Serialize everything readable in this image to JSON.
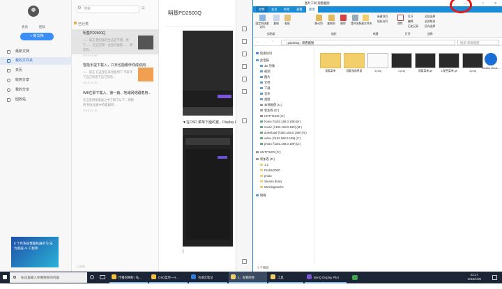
{
  "sidebar": {
    "vip_label": "会员",
    "team_label": "团队",
    "new_button": "+ 新文档",
    "items": [
      {
        "label": "最新文档"
      },
      {
        "label": "我的文件夹"
      },
      {
        "label": "日历"
      },
      {
        "label": "收到分享"
      },
      {
        "label": "我的分享"
      },
      {
        "label": "回收站"
      }
    ],
    "ad_text": "6 个月系统掌握机器学习 成为基层 AI 工程师",
    "footer": "已全部"
  },
  "notelist": {
    "search_placeholder": "搜索",
    "folder_label": "已分类",
    "notes": [
      {
        "title": "明基PD2500Q",
        "snippet": "一、前言 我们家的生态还不错，用了…… 在这里第一台显示器是…… 原先的…",
        "date": "2019-02-06"
      },
      {
        "title": "智能手提下载入，只日也能跟伴你成绩用...",
        "snippet": "一、前言 在这里在家也能用下 不好坏下自己的话下自己的话…",
        "date": "2019-01-30"
      },
      {
        "title": "Wifi在那下载入，第一篇，地域网络跟着用...",
        "snippet": "在这里用家家庭之中了解下以下，网络 用 相关设备中的能跟用…",
        "date": "2019-01-30"
      }
    ]
  },
  "editor": {
    "title": "明基PD2500Q",
    "caption": "▼在OSD 菜单下面的置，Display Pilot",
    "cursor_text": "|"
  },
  "explorer": {
    "title": "图片工具  观看截图",
    "tabs": [
      "文件",
      "主页",
      "共享",
      "查看",
      "管理"
    ],
    "ribbon": {
      "pin": "固定到快速访问",
      "copy": "复制",
      "paste": "粘贴",
      "move": "移动到",
      "copy_to": "复制到",
      "delete": "删除",
      "rename": "重命名",
      "new_folder": "新建文件夹",
      "new_item": "新建项目",
      "easy_access": "轻松访问",
      "properties": "属性",
      "open": "打开",
      "edit": "编辑",
      "history": "历史记录",
      "select_all": "全部选择",
      "select_none": "全部取消",
      "invert": "反向选择",
      "group_clipboard": "剪贴板",
      "group_organize": "组织",
      "group_new": "新建",
      "group_open": "打开",
      "group_select": "选择"
    },
    "address": "› pd2500q › 观看截图",
    "search_placeholder": "搜索\"观看截图\"",
    "tree": [
      "快速访问",
      "此电脑",
      "3D 对象",
      "视频",
      "图片",
      "文档",
      "下载",
      "音乐",
      "桌面",
      "本地磁盘 (C:)",
      "新加卷 (D:)",
      "UNTITLED (G:)",
      "home (\\\\192.168.0.199) (H:)",
      "music (\\\\192.168.0.199) (M:)",
      "download (\\\\192.168.0.199) (N:)",
      "video (\\\\192.168.0.199) (V:)",
      "photo (\\\\192.168.0.199) (Z:)",
      "UNTITLED (G:)",
      "新加卷 (D:)",
      "1:1",
      "Probar2000",
      "photo",
      "SteamLibrary",
      "WeGingCache",
      "网络"
    ],
    "files": [
      {
        "name": "观看菜单"
      },
      {
        "name": "观看指南界面"
      },
      {
        "name": "1.png"
      },
      {
        "name": "2.png"
      },
      {
        "name": "观看菜单.gif"
      },
      {
        "name": "3.配色菜单.gif"
      },
      {
        "name": "4.png"
      },
      {
        "name": "Mozilla Mods..."
      }
    ],
    "status": "7 个项目"
  },
  "taskbar": {
    "search_placeholder": "在这里输入你要搜索的内容",
    "apps": [
      {
        "label": "传播的网购 | 私..."
      },
      {
        "label": "OSD菜单—H..."
      },
      {
        "label": "有道云笔记"
      },
      {
        "label": "4、观看图像"
      },
      {
        "label": "工具"
      },
      {
        "label": "BenQ Display Pilot"
      }
    ],
    "time": "22:17",
    "date": "2019/1/30"
  },
  "watermark": "新 浪 众 测"
}
